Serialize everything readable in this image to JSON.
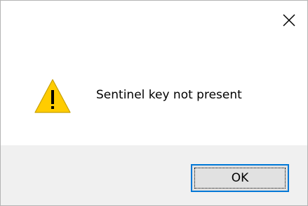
{
  "dialog": {
    "message": "Sentinel key not present",
    "icon": "warning-icon",
    "close_icon": "close-icon",
    "ok_label": "OK"
  },
  "colors": {
    "warning_fill": "#ffcc00",
    "footer_background": "#f0f0f0",
    "focus_border": "#0078d7"
  }
}
